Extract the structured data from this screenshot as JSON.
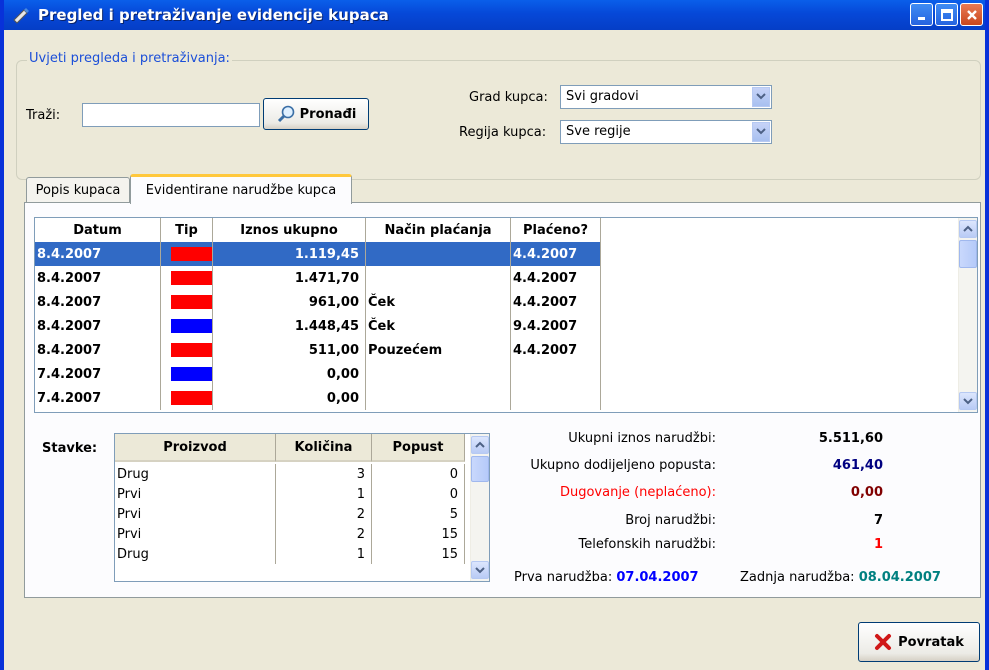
{
  "window": {
    "title": "Pregled i pretraživanje evidencije kupaca"
  },
  "filter": {
    "legend": "Uvjeti pregleda i pretraživanja:",
    "search_label": "Traži:",
    "search_value": "",
    "find_button": "Pronađi",
    "city_label": "Grad kupca:",
    "city_value": "Svi gradovi",
    "region_label": "Regija kupca:",
    "region_value": "Sve regije"
  },
  "tabs": [
    {
      "label": "Popis kupaca"
    },
    {
      "label": "Evidentirane narudžbe kupca"
    }
  ],
  "orders": {
    "columns": [
      "Datum",
      "Tip",
      "Iznos ukupno",
      "Način plaćanja",
      "Plaćeno?"
    ],
    "rows": [
      {
        "date": "8.4.2007",
        "type": "red",
        "amount": "1.119,45",
        "payment": "",
        "paid": "4.4.2007"
      },
      {
        "date": "8.4.2007",
        "type": "red",
        "amount": "1.471,70",
        "payment": "",
        "paid": "4.4.2007"
      },
      {
        "date": "8.4.2007",
        "type": "red",
        "amount": "961,00",
        "payment": "Ček",
        "paid": "4.4.2007"
      },
      {
        "date": "8.4.2007",
        "type": "blue",
        "amount": "1.448,45",
        "payment": "Ček",
        "paid": "9.4.2007"
      },
      {
        "date": "8.4.2007",
        "type": "red",
        "amount": "511,00",
        "payment": "Pouzećem",
        "paid": "4.4.2007"
      },
      {
        "date": "7.4.2007",
        "type": "blue",
        "amount": "0,00",
        "payment": "",
        "paid": ""
      },
      {
        "date": "7.4.2007",
        "type": "red",
        "amount": "0,00",
        "payment": "",
        "paid": ""
      }
    ]
  },
  "items": {
    "label": "Stavke:",
    "columns": [
      "Proizvod",
      "Količina",
      "Popust"
    ],
    "rows": [
      {
        "product": "Drug",
        "qty": "3",
        "discount": "0"
      },
      {
        "product": "Prvi",
        "qty": "1",
        "discount": "0"
      },
      {
        "product": "Prvi",
        "qty": "2",
        "discount": "5"
      },
      {
        "product": "Prvi",
        "qty": "2",
        "discount": "15"
      },
      {
        "product": "Drug",
        "qty": "1",
        "discount": "15"
      }
    ]
  },
  "stats": {
    "total_label": "Ukupni iznos narudžbi:",
    "total_value": "5.511,60",
    "discount_label": "Ukupno dodijeljeno popusta:",
    "discount_value": "461,40",
    "debt_label": "Dugovanje (neplaćeno):",
    "debt_value": "0,00",
    "count_label": "Broj narudžbi:",
    "count_value": "7",
    "phone_label": "Telefonskih narudžbi:",
    "phone_value": "1",
    "first_label": "Prva narudžba:",
    "first_value": "07.04.2007",
    "last_label": "Zadnja narudžba:",
    "last_value": "08.04.2007"
  },
  "back_button": "Povratak",
  "colors": {
    "type_red": "#FF0000",
    "type_blue": "#0000FF",
    "selection": "#316AC5",
    "discount_value": "#000080",
    "debt_label": "#FF0000",
    "debt_value": "#800000",
    "phone_value": "#FF0000",
    "first_value": "#0000FF",
    "last_value": "#008080"
  }
}
